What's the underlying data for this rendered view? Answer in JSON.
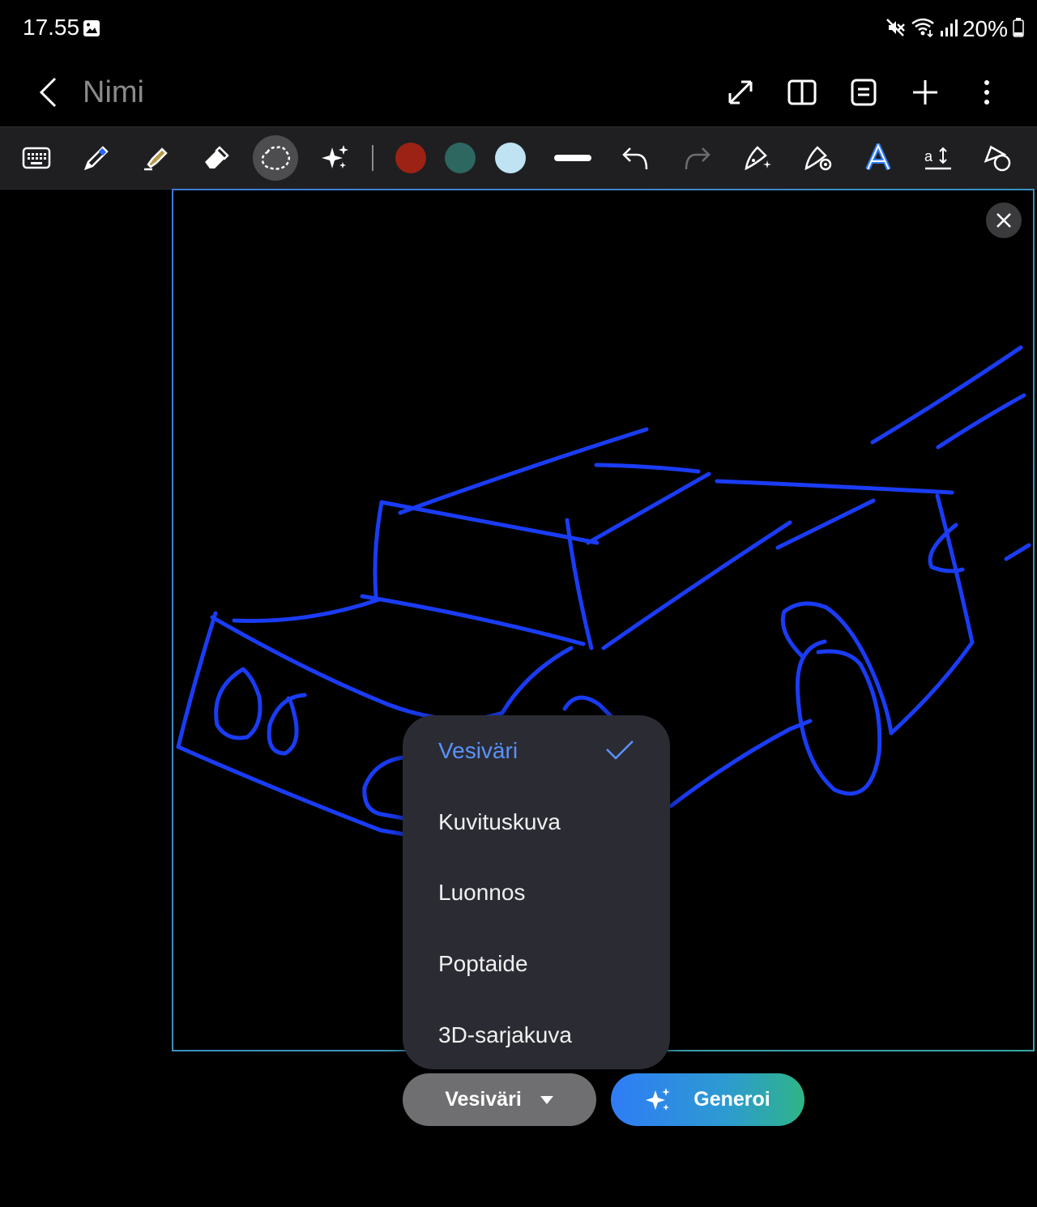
{
  "status_bar": {
    "time": "17.55",
    "battery": "20%",
    "icons": [
      "gallery-icon",
      "mute-icon",
      "wifi-icon",
      "signal-icon",
      "battery-icon"
    ]
  },
  "app_bar": {
    "title": "Nimi",
    "actions": [
      "expand-icon",
      "book-view-icon",
      "page-layout-icon",
      "add-icon",
      "more-icon"
    ]
  },
  "toolbar": {
    "tools": [
      "keyboard-icon",
      "pen-icon",
      "highlighter-icon",
      "eraser-icon",
      "lasso-select-icon",
      "ai-assist-icon"
    ],
    "selected_tool": "lasso-select-icon",
    "colors": [
      "#9b2214",
      "#2e6660",
      "#bfe3f3"
    ],
    "right_tools": [
      "stroke-width-icon",
      "undo-icon",
      "redo-icon",
      "sketch-assist-icon",
      "shape-assist-icon",
      "handwriting-text-icon",
      "text-format-icon",
      "shapes-icon"
    ]
  },
  "drawing": {
    "stroke_color": "#1a3cf5"
  },
  "style_menu": {
    "items": [
      {
        "label": "Vesiväri",
        "selected": true
      },
      {
        "label": "Kuvituskuva",
        "selected": false
      },
      {
        "label": "Luonnos",
        "selected": false
      },
      {
        "label": "Poptaide",
        "selected": false
      },
      {
        "label": "3D-sarjakuva",
        "selected": false
      }
    ]
  },
  "bottom_actions": {
    "style_selector_label": "Vesiväri",
    "generate_label": "Generoi"
  }
}
